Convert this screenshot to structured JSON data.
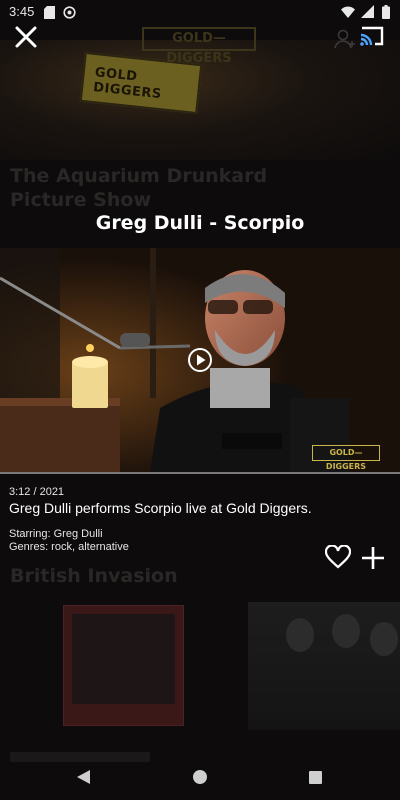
{
  "status_bar": {
    "time": "3:45",
    "left_icons": [
      "sd-card-icon",
      "vpn-icon"
    ],
    "right_icons": [
      "wifi-icon",
      "signal-icon",
      "battery-icon"
    ]
  },
  "background": {
    "logo_text": "GOLD—DIGGERS",
    "sign_text": "GOLD DIGGERS",
    "section_title": "The Aquarium Drunkard Picture Show",
    "section2_title": "British Invasion"
  },
  "player": {
    "title": "Greg Dulli - Scorpio",
    "watermark": "GOLD—DIGGERS",
    "duration_year": "3:12 / 2021",
    "description": "Greg Dulli performs Scorpio live at Gold Diggers.",
    "starring": "Starring: Greg Dulli",
    "genres": "Genres: rock, alternative"
  },
  "icons": {
    "close": "close-icon",
    "cast": "cast-icon",
    "play": "play-icon",
    "favorite": "heart-icon",
    "add": "plus-icon"
  },
  "colors": {
    "background": "#0d0b0b",
    "text": "#ffffff",
    "logo_gold": "#c9b54a"
  }
}
